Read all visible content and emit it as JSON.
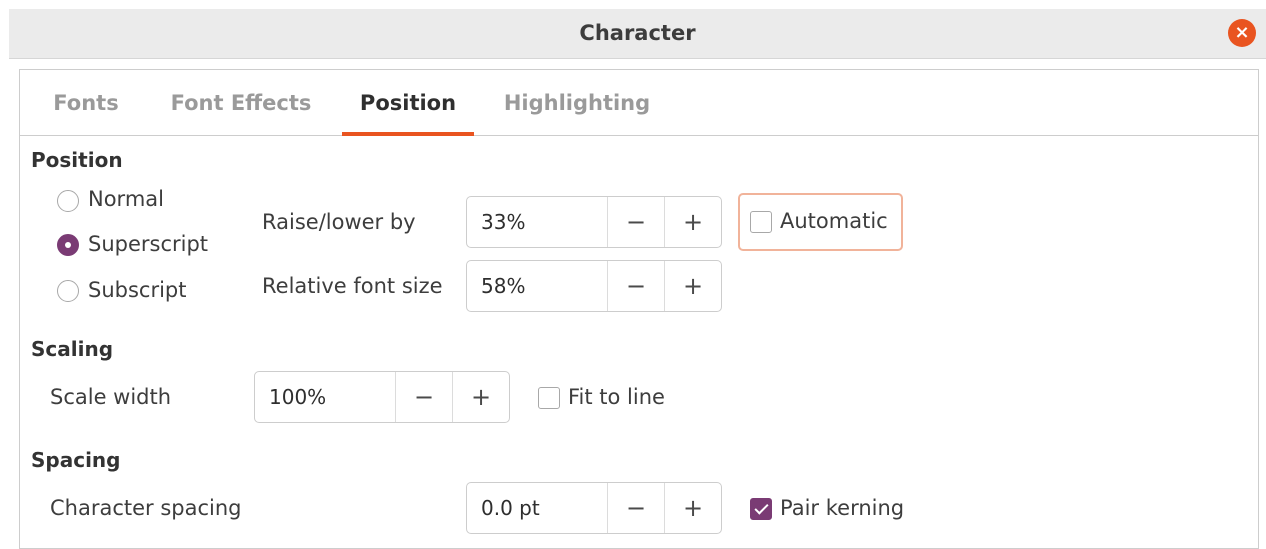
{
  "window": {
    "title": "Character"
  },
  "tabs": [
    "Fonts",
    "Font Effects",
    "Position",
    "Highlighting"
  ],
  "position_section": {
    "heading": "Position",
    "options": [
      "Normal",
      "Superscript",
      "Subscript"
    ],
    "selected": "Superscript",
    "raise_lower": {
      "label": "Raise/lower by",
      "value": "33%"
    },
    "relative_size": {
      "label": "Relative font size",
      "value": "58%"
    },
    "automatic": {
      "label": "Automatic",
      "checked": false
    }
  },
  "scaling_section": {
    "heading": "Scaling",
    "scale_width": {
      "label": "Scale width",
      "value": "100%"
    },
    "fit_to_line": {
      "label": "Fit to line",
      "checked": false
    }
  },
  "spacing_section": {
    "heading": "Spacing",
    "char_spacing": {
      "label": "Character spacing",
      "value": "0.0 pt"
    },
    "pair_kerning": {
      "label": "Pair kerning",
      "checked": true
    }
  },
  "controls": {
    "minus": "−",
    "plus": "+",
    "close": "×"
  },
  "colors": {
    "accent": "#e95420",
    "checked": "#7a3b74"
  }
}
